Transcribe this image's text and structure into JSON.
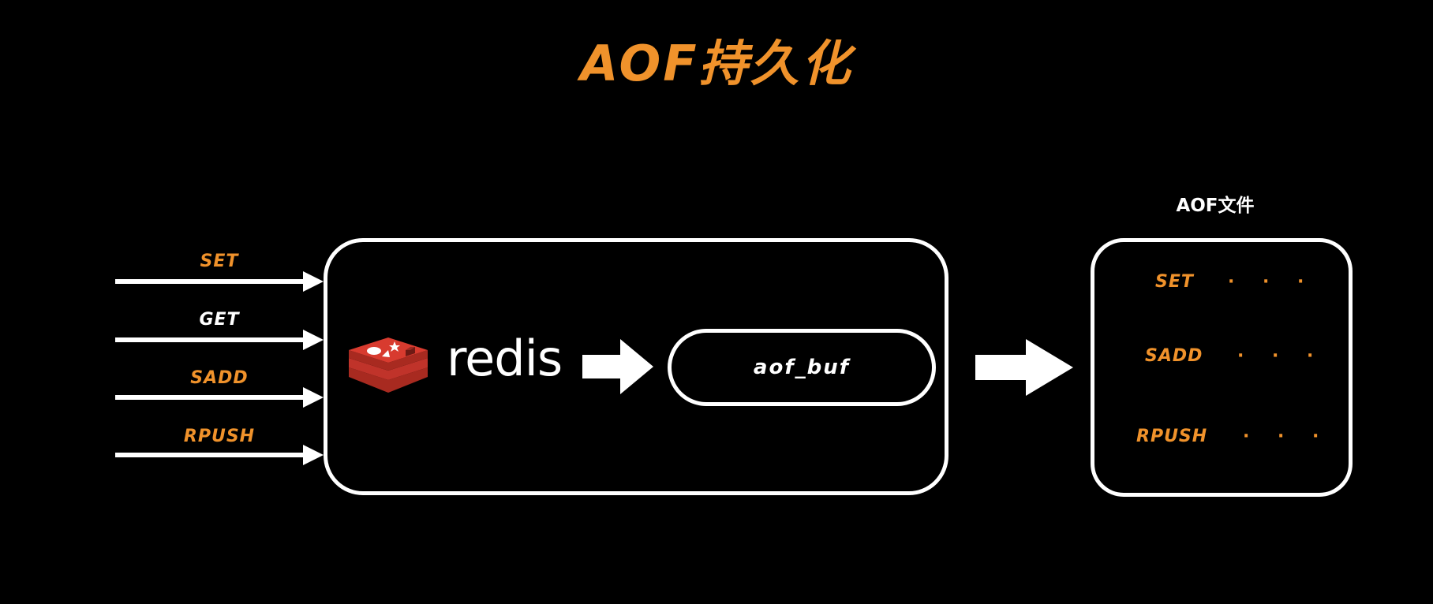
{
  "title": "AOF持久化",
  "colors": {
    "background": "#000000",
    "accent": "#f0922b",
    "stroke": "#ffffff",
    "redis_red": "#d03a2f"
  },
  "inputs": [
    {
      "label": "SET",
      "color": "#f0922b"
    },
    {
      "label": "GET",
      "color": "#ffffff"
    },
    {
      "label": "SADD",
      "color": "#f0922b"
    },
    {
      "label": "RPUSH",
      "color": "#f0922b"
    }
  ],
  "redis": {
    "logo_icon": "redis-logo-icon",
    "wordmark": "redis"
  },
  "buffer": {
    "label": "aof_buf"
  },
  "file": {
    "title": "AOF文件",
    "lines": [
      {
        "command": "SET",
        "ellipsis": "· · ·"
      },
      {
        "command": "SADD",
        "ellipsis": "· · ·"
      },
      {
        "command": "RPUSH",
        "ellipsis": "· · ·"
      }
    ]
  }
}
